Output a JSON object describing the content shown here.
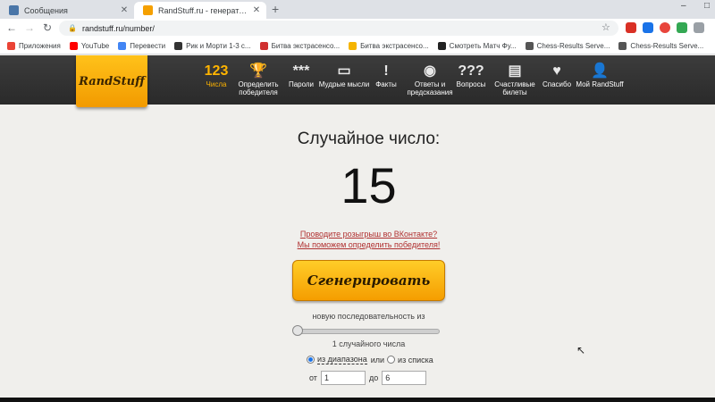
{
  "browser": {
    "tabs": [
      {
        "title": "Сообщения",
        "active": false,
        "color": "#4a76a8"
      },
      {
        "title": "RandStuff.ru - генератор случайн",
        "active": true,
        "color": "#f5a000"
      }
    ],
    "url": "randstuff.ru/number/",
    "bookmarks": [
      {
        "label": "Приложения",
        "color": "#ea4335"
      },
      {
        "label": "YouTube",
        "color": "#ff0000"
      },
      {
        "label": "Перевести",
        "color": "#4285f4"
      },
      {
        "label": "Рик и Морти 1-3 с...",
        "color": "#333333"
      },
      {
        "label": "Битва экстрасенсо...",
        "color": "#d03030"
      },
      {
        "label": "Битва экстрасенсо...",
        "color": "#f5b400"
      },
      {
        "label": "Смотреть Матч Фу...",
        "color": "#222222"
      },
      {
        "label": "Chess-Results Serve...",
        "color": "#555555"
      },
      {
        "label": "Chess-Results Serve...",
        "color": "#555555"
      }
    ]
  },
  "site": {
    "logo": "RandStuff",
    "nav": [
      {
        "icon": "123",
        "label": "Числа",
        "name": "numbers",
        "active": true
      },
      {
        "icon": "🏆",
        "label": "Определить победителя",
        "name": "winner",
        "active": false
      },
      {
        "icon": "***",
        "label": "Пароли",
        "name": "passwords",
        "active": false
      },
      {
        "icon": "▭",
        "label": "Мудрые мысли",
        "name": "wise-thoughts",
        "active": false
      },
      {
        "icon": "!",
        "label": "Факты",
        "name": "facts",
        "active": false
      },
      {
        "icon": "◉",
        "label": "Ответы и предсказания",
        "name": "answers",
        "active": false
      },
      {
        "icon": "???",
        "label": "Вопросы",
        "name": "questions",
        "active": false
      },
      {
        "icon": "▤",
        "label": "Счастливые билеты",
        "name": "tickets",
        "active": false
      },
      {
        "icon": "♥",
        "label": "Спасибо",
        "name": "thanks",
        "active": false
      },
      {
        "icon": "👤",
        "label": "Мой RandStuff",
        "name": "my-randstuff",
        "active": false
      }
    ]
  },
  "main": {
    "heading": "Случайное число:",
    "number": "15",
    "promo_line1": "Проводите розыгрыш во ВКонтакте?",
    "promo_line2": "Мы поможем определить победителя!",
    "generate_label": "Сгенерировать",
    "sequence_label": "новую последовательность из",
    "count_label": "1 случайного числа",
    "slider_value": 1,
    "radio_range": "из диапазона",
    "radio_or": "или",
    "radio_list": "из списка",
    "from_label": "от",
    "from_value": "1",
    "to_label": "до",
    "to_value": "6"
  }
}
